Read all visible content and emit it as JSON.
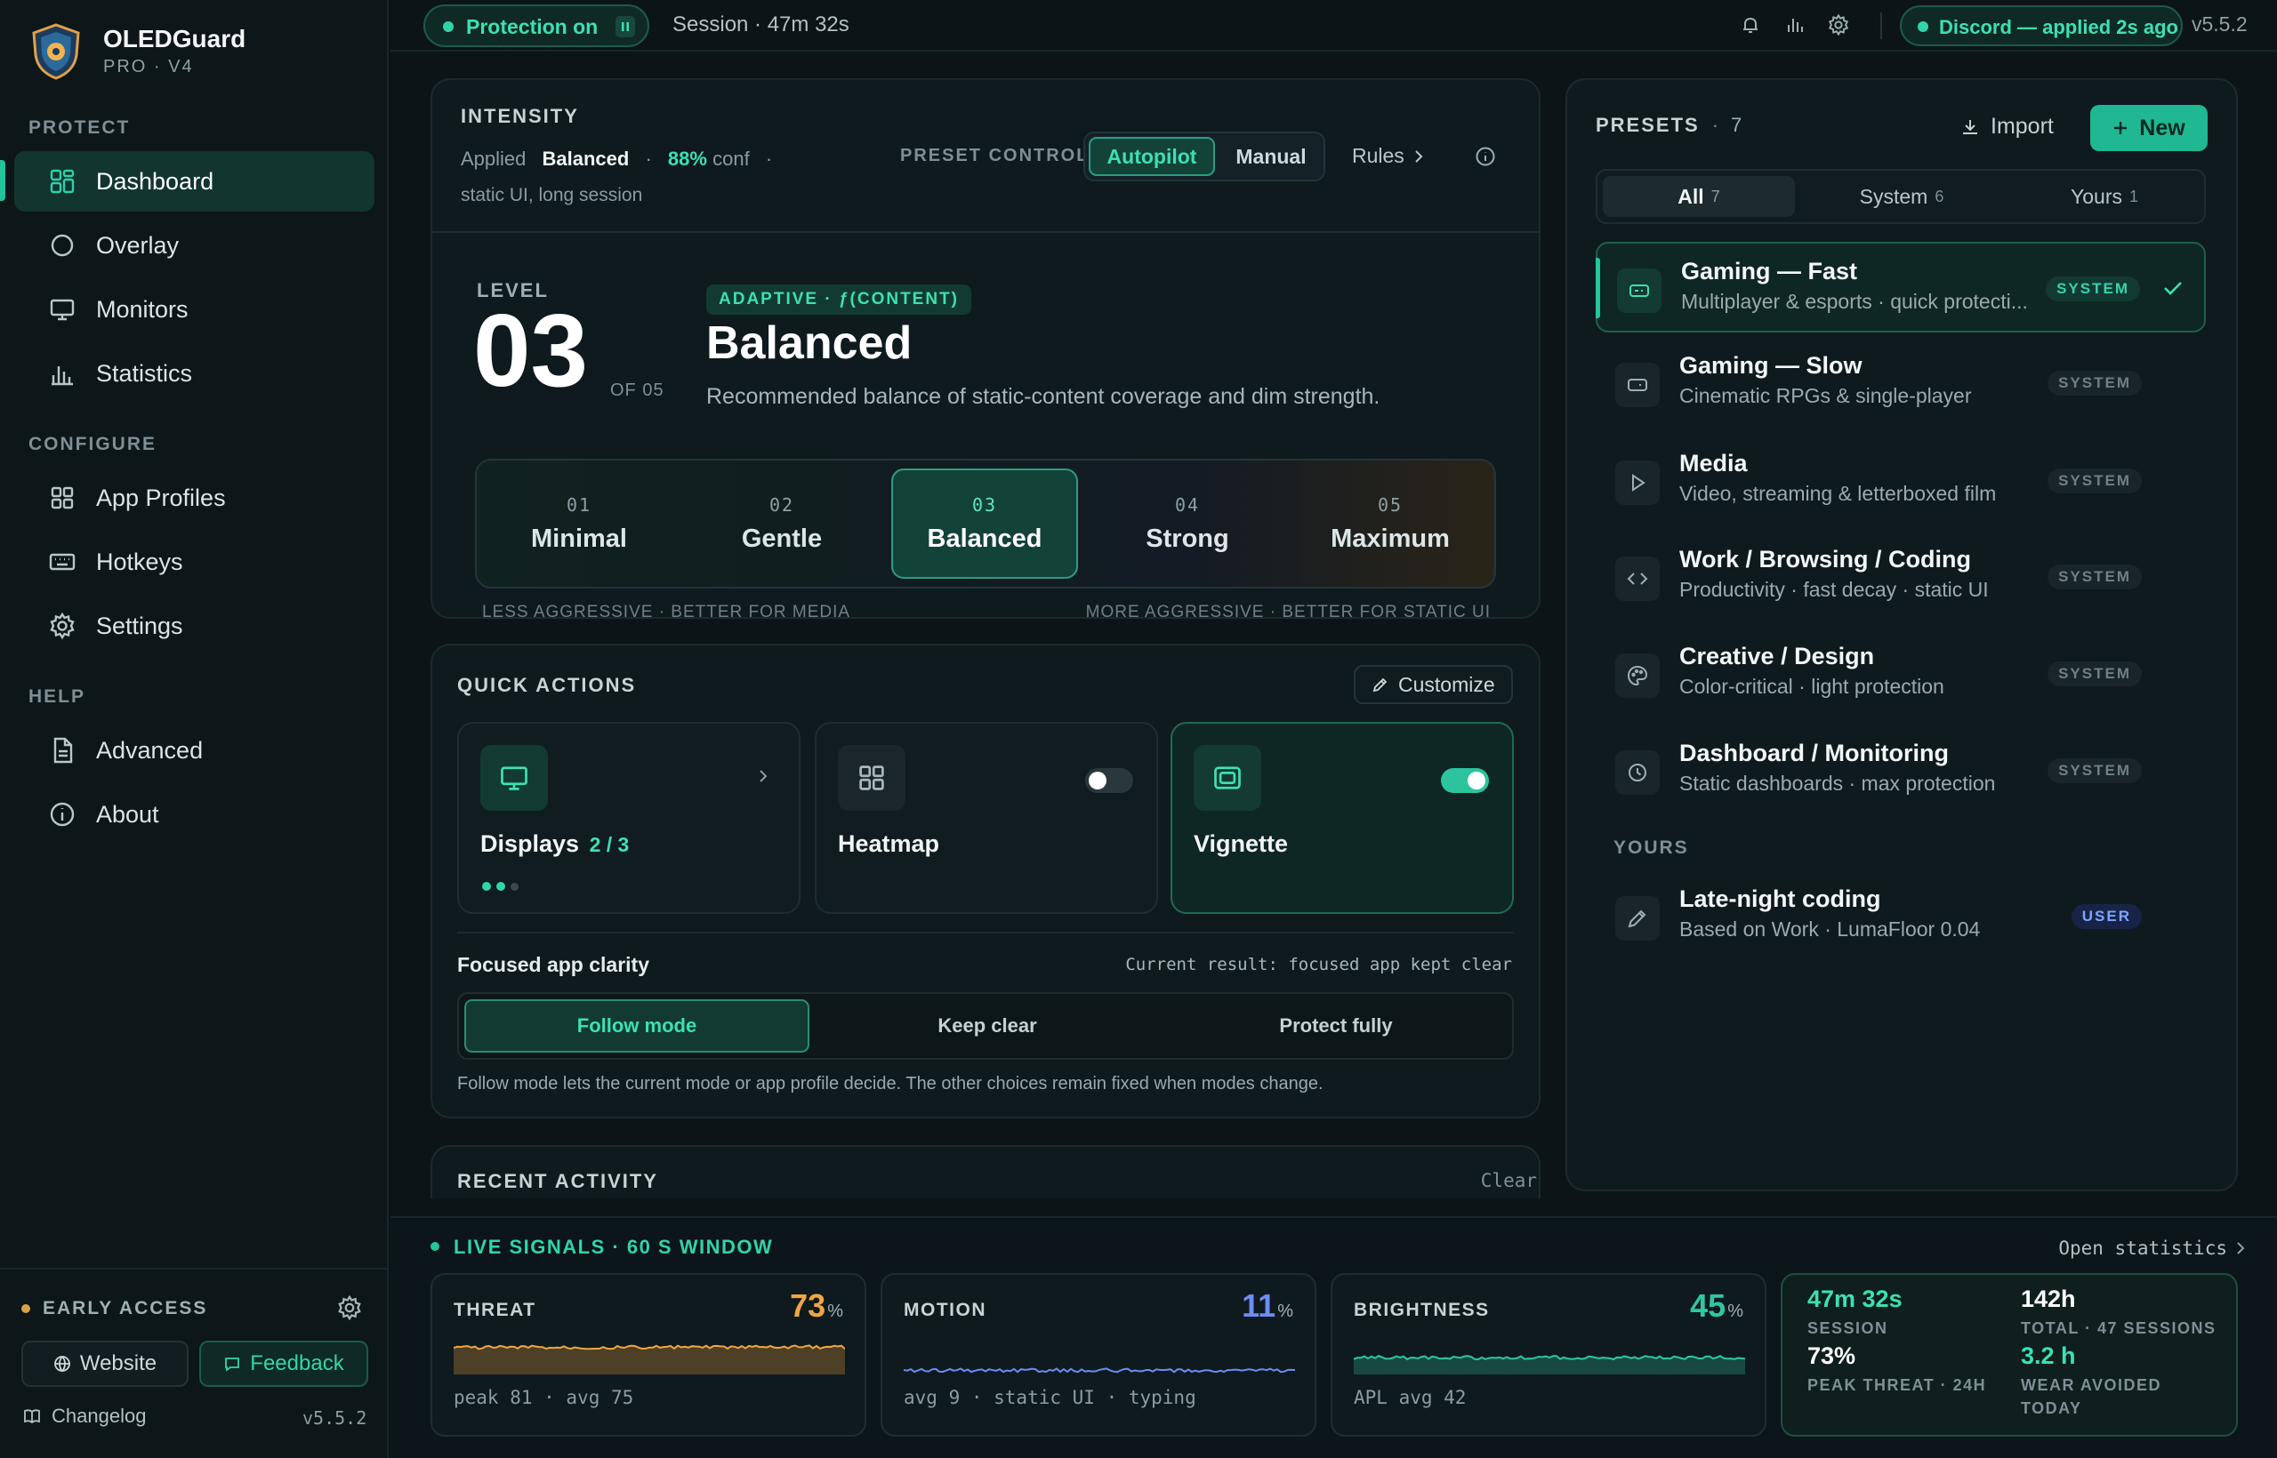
{
  "brand": {
    "name": "OLEDGuard",
    "sub": "PRO · V4"
  },
  "nav": {
    "sections": {
      "protect": "PROTECT",
      "configure": "CONFIGURE",
      "help": "HELP"
    },
    "items": [
      {
        "label": "Dashboard",
        "icon": "dashboard-icon"
      },
      {
        "label": "Overlay",
        "icon": "circle-icon"
      },
      {
        "label": "Monitors",
        "icon": "monitor-icon"
      },
      {
        "label": "Statistics",
        "icon": "bar-chart-icon"
      },
      {
        "label": "App Profiles",
        "icon": "grid-icon"
      },
      {
        "label": "Hotkeys",
        "icon": "keyboard-icon"
      },
      {
        "label": "Settings",
        "icon": "gear-icon"
      },
      {
        "label": "Advanced",
        "icon": "document-icon"
      },
      {
        "label": "About",
        "icon": "info-icon"
      }
    ]
  },
  "footer": {
    "early_access": "EARLY ACCESS",
    "website": "Website",
    "feedback": "Feedback",
    "changelog": "Changelog",
    "version": "v5.5.2"
  },
  "topbar": {
    "protection": "Protection on",
    "session": "Session · 47m 32s",
    "discord": "Discord — applied 2s ago",
    "version": "v5.5.2"
  },
  "intensity": {
    "title": "INTENSITY",
    "applied_prefix": "Applied",
    "applied_value": "Balanced",
    "conf_value": "88%",
    "conf_suffix": "conf",
    "applied_detail": "static UI, long session",
    "preset_control": "PRESET CONTROL",
    "autopilot": "Autopilot",
    "manual": "Manual",
    "rules": "Rules",
    "level_label": "LEVEL",
    "level_value": "03",
    "level_of": "OF 05",
    "adaptive_badge": "ADAPTIVE · ƒ(CONTENT)",
    "level_name": "Balanced",
    "level_desc": "Recommended balance of static-content coverage and dim strength.",
    "levels": [
      {
        "n": "01",
        "t": "Minimal"
      },
      {
        "n": "02",
        "t": "Gentle"
      },
      {
        "n": "03",
        "t": "Balanced"
      },
      {
        "n": "04",
        "t": "Strong"
      },
      {
        "n": "05",
        "t": "Maximum"
      }
    ],
    "hint_left": "LESS AGGRESSIVE · BETTER FOR MEDIA",
    "hint_right": "MORE AGGRESSIVE · BETTER FOR STATIC UI"
  },
  "quick_actions": {
    "title": "QUICK ACTIONS",
    "customize": "Customize",
    "displays": "Displays",
    "displays_count": "2 / 3",
    "heatmap": "Heatmap",
    "heatmap_on": false,
    "vignette": "Vignette",
    "vignette_on": true,
    "clarity_title": "Focused app clarity",
    "clarity_result": "Current result: focused app kept clear",
    "clarity_options": [
      "Follow mode",
      "Keep clear",
      "Protect fully"
    ],
    "clarity_note": "Follow mode lets the current mode or app profile decide. The other choices remain fixed when modes change."
  },
  "recent": {
    "title": "RECENT ACTIVITY",
    "clear": "Clear"
  },
  "presets": {
    "title": "PRESETS",
    "count": "7",
    "import": "Import",
    "new": "New",
    "tabs": [
      {
        "label": "All",
        "count": "7"
      },
      {
        "label": "System",
        "count": "6"
      },
      {
        "label": "Yours",
        "count": "1"
      }
    ],
    "items": [
      {
        "title": "Gaming — Fast",
        "desc": "Multiplayer & esports · quick protecti...",
        "badge": "SYSTEM"
      },
      {
        "title": "Gaming — Slow",
        "desc": "Cinematic RPGs & single-player",
        "badge": "SYSTEM"
      },
      {
        "title": "Media",
        "desc": "Video, streaming & letterboxed film",
        "badge": "SYSTEM"
      },
      {
        "title": "Work / Browsing / Coding",
        "desc": "Productivity · fast decay · static UI",
        "badge": "SYSTEM"
      },
      {
        "title": "Creative / Design",
        "desc": "Color-critical · light protection",
        "badge": "SYSTEM"
      },
      {
        "title": "Dashboard / Monitoring",
        "desc": "Static dashboards · max protection",
        "badge": "SYSTEM"
      }
    ],
    "yours_label": "YOURS",
    "user_item": {
      "title": "Late-night coding",
      "desc": "Based on Work · LumaFloor 0.04",
      "badge": "USER"
    }
  },
  "signals": {
    "title": "LIVE SIGNALS · 60 S WINDOW",
    "open_stats": "Open statistics",
    "threat": {
      "label": "THREAT",
      "value": "73",
      "unit": "%",
      "foot": "peak 81 · avg 75",
      "color": "#f0a640"
    },
    "motion": {
      "label": "MOTION",
      "value": "11",
      "unit": "%",
      "foot": "avg 9 · static UI · typing",
      "color": "#6d8cf5"
    },
    "brightness": {
      "label": "BRIGHTNESS",
      "value": "45",
      "unit": "%",
      "foot": "APL avg 42",
      "color": "#2fc7a2"
    },
    "stats": {
      "session_v": "47m 32s",
      "session_l": "SESSION",
      "total_v": "142h",
      "total_l": "TOTAL · 47 SESSIONS",
      "peak_v": "73%",
      "peak_l": "PEAK THREAT · 24H",
      "wear_v": "3.2 h",
      "wear_l1": "WEAR AVOIDED",
      "wear_l2": "TODAY"
    }
  }
}
